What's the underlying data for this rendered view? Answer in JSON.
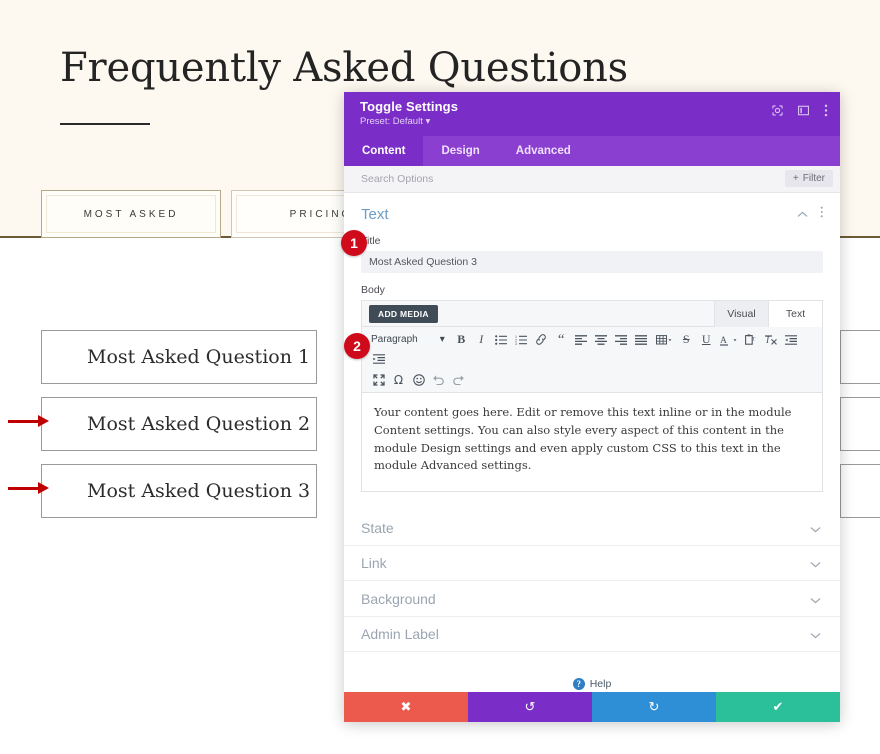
{
  "site": {
    "heading": "Frequently Asked Questions",
    "tabs": [
      {
        "label": "MOST ASKED",
        "active": true
      },
      {
        "label": "PRICING",
        "active": false
      }
    ],
    "toggles_left": [
      "Most Asked Question 1",
      "Most Asked Question 2",
      "Most Asked Question 3"
    ],
    "toggles_right": [
      "",
      "",
      ""
    ],
    "colors": {
      "cream_background": "#fdf9f0",
      "divider": "#6b5b36",
      "tab_border": "#b3a887",
      "heading_text": "#242424",
      "annotation_arrow": "#c00000"
    }
  },
  "annotations": {
    "badges": [
      {
        "number": "1",
        "target": "title-field"
      },
      {
        "number": "2",
        "target": "body-editor"
      }
    ],
    "arrows": [
      {
        "target": "toggle-2"
      },
      {
        "target": "toggle-3"
      }
    ]
  },
  "modal": {
    "title": "Toggle Settings",
    "preset": "Preset: Default",
    "preset_caret": "▾",
    "header_icons": [
      {
        "name": "expand-icon"
      },
      {
        "name": "panel-layout-icon"
      },
      {
        "name": "more-vertical-icon"
      }
    ],
    "tabs": [
      {
        "label": "Content",
        "active": true
      },
      {
        "label": "Design",
        "active": false
      },
      {
        "label": "Advanced",
        "active": false
      }
    ],
    "search": {
      "placeholder": "Search Options",
      "value": ""
    },
    "filter_button": {
      "label": "Filter",
      "plus": "+"
    },
    "section_text": {
      "title": "Text",
      "collapse_caret": "∧",
      "more_icon": "⋮"
    },
    "fields": {
      "title_label": "Title",
      "title_value": "Most Asked Question 3",
      "body_label": "Body"
    },
    "editor": {
      "add_media_label": "ADD MEDIA",
      "mode_tabs": [
        {
          "label": "Visual",
          "active": false
        },
        {
          "label": "Text",
          "active": true
        }
      ],
      "format_select": "Paragraph",
      "format_caret": "▾",
      "toolbar_row1": [
        "bold-icon",
        "italic-icon",
        "bulleted-list-icon",
        "numbered-list-icon",
        "link-icon",
        "blockquote-icon",
        "align-left-icon",
        "align-center-icon",
        "align-right-icon",
        "align-justify-icon",
        "table-icon",
        "strikethrough-icon",
        "underline-icon",
        "text-color-icon",
        "paste-as-text-icon",
        "clear-formatting-icon",
        "outdent-icon",
        "indent-icon"
      ],
      "toolbar_row2": [
        "fullscreen-icon",
        "special-character-icon",
        "emoji-icon",
        "undo-icon",
        "redo-icon"
      ],
      "body_text": "Your content goes here. Edit or remove this text inline or in the module Content settings. You can also style every aspect of this content in the module Design settings and even apply custom CSS to this text in the module Advanced settings."
    },
    "collapsible_sections": [
      {
        "label": "State",
        "caret": "⌄"
      },
      {
        "label": "Link",
        "caret": "⌄"
      },
      {
        "label": "Background",
        "caret": "⌄"
      },
      {
        "label": "Admin Label",
        "caret": "⌄"
      }
    ],
    "help": {
      "label": "Help",
      "icon_glyph": "?"
    },
    "actions": [
      {
        "name": "cancel",
        "glyph": "✖",
        "color": "#ec5a4e"
      },
      {
        "name": "undo",
        "glyph": "↺",
        "color": "#7b2ec7"
      },
      {
        "name": "redo",
        "glyph": "↻",
        "color": "#2f8fd6"
      },
      {
        "name": "save",
        "glyph": "✔",
        "color": "#2bbf9a"
      }
    ]
  }
}
